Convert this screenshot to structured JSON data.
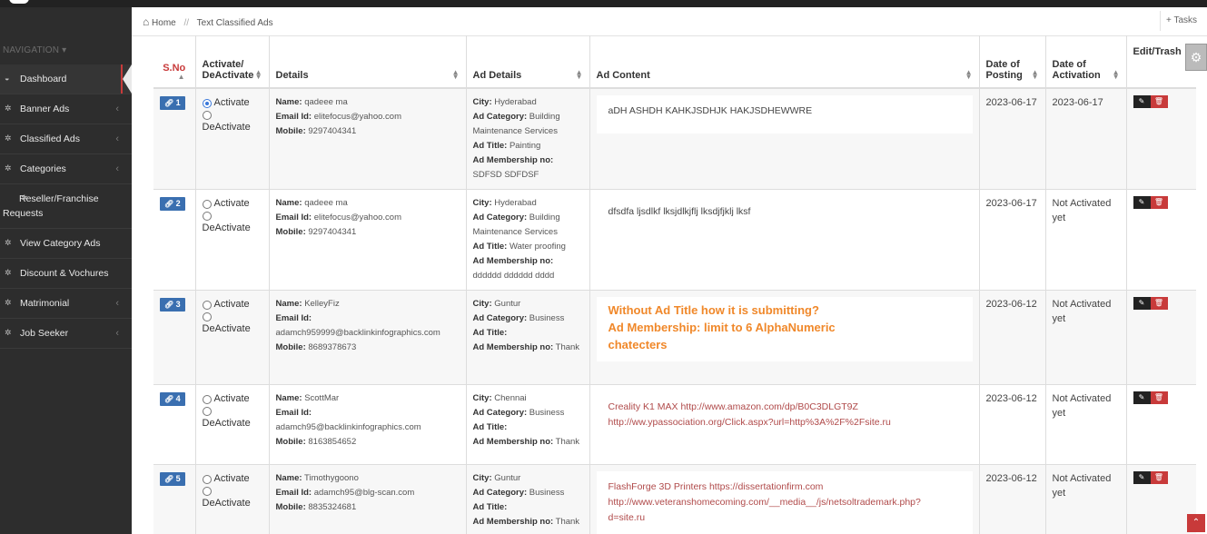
{
  "nav": {
    "heading": "NAVIGATION",
    "items": [
      {
        "label": "Dashboard",
        "icon": "dashboard-icon",
        "glyph": "◒"
      },
      {
        "label": "Banner Ads",
        "icon": "gear-icon",
        "glyph": "✲"
      },
      {
        "label": "Classified Ads",
        "icon": "gear-icon",
        "glyph": "✲"
      },
      {
        "label": "Categories",
        "icon": "gear-icon",
        "glyph": "✲"
      },
      {
        "label": "Reseller/Franchise Requests",
        "icon": "gear-icon",
        "glyph": "✲"
      },
      {
        "label": "View Category Ads",
        "icon": "gear-icon",
        "glyph": "✲"
      },
      {
        "label": "Discount & Vochures",
        "icon": "gear-icon",
        "glyph": "✲"
      },
      {
        "label": "Matrimonial",
        "icon": "gear-icon",
        "glyph": "✲"
      },
      {
        "label": "Job Seeker",
        "icon": "gear-icon",
        "glyph": "✲"
      }
    ]
  },
  "breadcrumb": {
    "home": "Home",
    "sep": "//",
    "current": "Text Classified Ads"
  },
  "tasks_label": "Tasks",
  "columns": {
    "sno": "S.No",
    "activate": "Activate/ DeActivate",
    "details": "Details",
    "ad_details": "Ad Details",
    "ad_content": "Ad Content",
    "date_posting": "Date of Posting",
    "date_activation": "Date of Activation",
    "edit_trash": "Edit/Trash"
  },
  "labels": {
    "activate": "Activate",
    "deactivate": "DeActivate",
    "name": "Name:",
    "email": "Email Id:",
    "mobile": "Mobile:",
    "city": "City:",
    "category": "Ad Category:",
    "title": "Ad Title:",
    "membership": "Ad Membership no:"
  },
  "rows": [
    {
      "sno": "1",
      "active": true,
      "name": "qadeee ma",
      "email": "elitefocus@yahoo.com",
      "mobile": "9297404341",
      "city": "Hyderabad",
      "category": "Building Maintenance Services",
      "title": "Painting",
      "membership": "SDFSD SDFDSF",
      "content": "aDH ASHDH KAHKJSDHJK HAKJSDHEWWRE",
      "posted": "2023-06-17",
      "activation": "2023-06-17"
    },
    {
      "sno": "2",
      "active": false,
      "name": "qadeee ma",
      "email": "elitefocus@yahoo.com",
      "mobile": "9297404341",
      "city": "Hyderabad",
      "category": "Building Maintenance Services",
      "title": "Water proofing",
      "membership": "dddddd dddddd dddd",
      "content": "dfsdfa ljsdlkf lksjdlkjflj lksdjfjklj lksf",
      "posted": "2023-06-17",
      "activation": "Not Activated yet"
    },
    {
      "sno": "3",
      "active": false,
      "name": "KelleyFiz",
      "email": "",
      "email_line2": "adamch959999@backlinkinfographics.com",
      "mobile": "8689378673",
      "city": "Guntur",
      "category": "Business",
      "title": "",
      "membership": "Thank",
      "content_lines": [
        "Without Ad Title how it is submitting?",
        "Ad Membership: limit to 6 AlphaNumeric",
        "chatecters"
      ],
      "posted": "2023-06-12",
      "activation": "Not Activated yet"
    },
    {
      "sno": "4",
      "active": false,
      "name": "ScottMar",
      "email": "",
      "email_line2": "adamch95@backlinkinfographics.com",
      "mobile": "8163854652",
      "city": "Chennai",
      "category": "Business",
      "title": "",
      "membership": "Thank",
      "content_lines": [
        "Creality K1 MAX http://www.amazon.com/dp/B0C3DLGT9Z",
        "http://ww.ypassociation.org/Click.aspx?url=http%3A%2F%2Fsite.ru"
      ],
      "posted": "2023-06-12",
      "activation": "Not Activated yet"
    },
    {
      "sno": "5",
      "active": false,
      "name": "Timothygoono",
      "email": "adamch95@blg-scan.com",
      "mobile": "8835324681",
      "city": "Guntur",
      "category": "Business",
      "title": "",
      "membership": "Thank",
      "content_lines": [
        "FlashForge 3D Printers https://dissertationfirm.com",
        "http://www.veteranshomecoming.com/__media__/js/netsoltrademark.php?",
        "d=site.ru"
      ],
      "posted": "2023-06-12",
      "activation": "Not Activated yet"
    }
  ]
}
